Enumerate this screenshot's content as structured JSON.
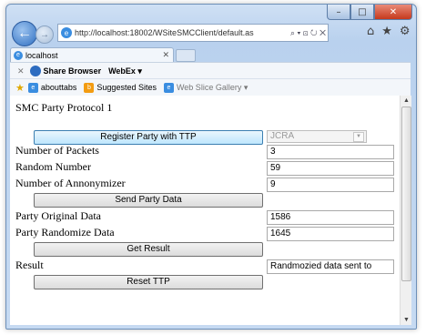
{
  "browser": {
    "url": "http://localhost:18002/WSiteSMCClient/default.as",
    "addr_controls": "⌕ ▾ ⊡ ↻ ✕",
    "tab_title": "localhost",
    "tab_close": "✕",
    "cmd_close": "✕",
    "share_browser": "Share Browser",
    "webex": "WebEx ▾",
    "favorites": [
      {
        "label": "abouttabs",
        "icon": "ie-page-icon",
        "color": "#3a8de0"
      },
      {
        "label": "Suggested Sites",
        "icon": "suggested-sites-icon",
        "color": "#f39c12"
      },
      {
        "label": "Web Slice Gallery ▾",
        "icon": "ie-page-icon",
        "color": "#3a8de0"
      }
    ]
  },
  "page": {
    "title": "SMC Party  Protocol 1",
    "register_button": "Register Party with TTP",
    "ttp_select": "JCRA",
    "fields": {
      "num_packets_label": "Number of Packets",
      "num_packets_value": "3",
      "random_number_label": "Random Number",
      "random_number_value": "59",
      "num_anonymizer_label": "Number of Annonymizer",
      "num_anonymizer_value": "9",
      "send_button": "Send Party Data",
      "original_label": "Party Original Data",
      "original_value": "1586",
      "randomize_label": "Party Randomize Data",
      "randomize_value": "1645",
      "result_button": "Get Result",
      "result_label": "Result",
      "result_value": "Randmozied data sent to",
      "reset_button": "Reset TTP"
    }
  }
}
